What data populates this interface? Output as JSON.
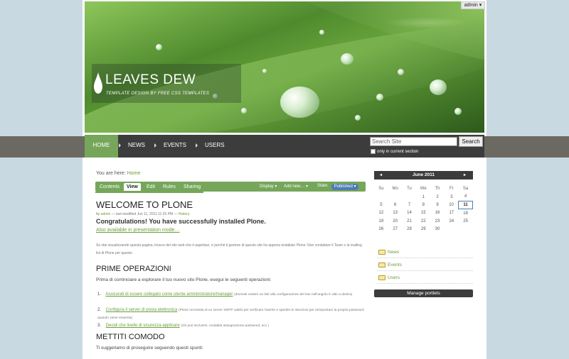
{
  "admin_menu": "admin ▾",
  "site": {
    "title": "LEAVES DEW",
    "subtitle": "TEMPLATE DESIGN BY FREE CSS TEMPLATES"
  },
  "nav": {
    "items": [
      {
        "label": "HOME"
      },
      {
        "label": "NEWS"
      },
      {
        "label": "EVENTS"
      },
      {
        "label": "USERS"
      }
    ]
  },
  "search": {
    "placeholder": "Search Site",
    "button": "Search",
    "only_current": "only in current section"
  },
  "breadcrumb": {
    "prefix": "You are here:",
    "current": "Home"
  },
  "tabs": {
    "contents": "Contents",
    "view": "View",
    "edit": "Edit",
    "rules": "Rules",
    "sharing": "Sharing",
    "display": "Display ▾",
    "add_new": "Add new… ▾",
    "state_label": "State:",
    "state_value": "Published ▾"
  },
  "content": {
    "title": "WELCOME TO PLONE",
    "byline_by": "by",
    "byline_author": "admin",
    "byline_modified": "— last modified Jun 11, 2011 11:25 PM —",
    "byline_history": "History",
    "congrats": "Congratulations! You have successfully installed Plone.",
    "presentation": "Also available in presentation mode…",
    "intro": "Se stai visualizzando questa pagina, invece del sito web che ti aspettavi, è perché il gestore di questo sito ha appena installato Plone. Non contattare il Team o la mailing list di Plone per questo.",
    "h_prime": "PRIME OPERAZIONI",
    "p_prime": "Prima di cominciare a esplorare il tuo nuovo sito Plone, esegui le seguenti operazioni:",
    "list": [
      {
        "num": "1.",
        "link": "Assicurati di essere collegato come utente amministratore/manager",
        "note": "(dovresti vedere un link alla configurazione del sito nell'angolo in alto a destra)"
      },
      {
        "num": "2.",
        "link": "Configura il server di posta elettronica",
        "note": "(Plone necessita di un server SMTP valido per verificare l'utente e spedire le istruzioni per reimpostare la propria password quando viene smarrita)"
      },
      {
        "num": "3.",
        "link": "Decidi che livello di sicurezza applicare",
        "note": "(chi può iscriversi, modalità assegnazione password, ecc.)"
      }
    ],
    "h_mettiti": "METTITI COMODO",
    "p_mettiti": "Ti suggeriamo di proseguire seguendo questi spunti:"
  },
  "calendar": {
    "month": "June 2011",
    "prev": "◂",
    "next": "▸",
    "weekdays": [
      "Su",
      "Mo",
      "Tu",
      "We",
      "Th",
      "Fr",
      "Sa"
    ],
    "weeks": [
      [
        "",
        "",
        "",
        "1",
        "2",
        "3",
        "4"
      ],
      [
        "5",
        "6",
        "7",
        "8",
        "9",
        "10",
        "11"
      ],
      [
        "12",
        "13",
        "14",
        "15",
        "16",
        "17",
        "18"
      ],
      [
        "19",
        "20",
        "21",
        "22",
        "23",
        "24",
        "25"
      ],
      [
        "26",
        "27",
        "28",
        "29",
        "30",
        "",
        ""
      ]
    ],
    "today": "11"
  },
  "portlet": {
    "items": [
      {
        "label": "News"
      },
      {
        "label": "Events"
      },
      {
        "label": "Users"
      }
    ],
    "manage": "Manage portlets"
  },
  "colors": {
    "accent_green": "#75a65a",
    "nav_dark": "#3c3c3c",
    "link_green": "#6a9e3a",
    "state_blue": "#4f7db0"
  }
}
